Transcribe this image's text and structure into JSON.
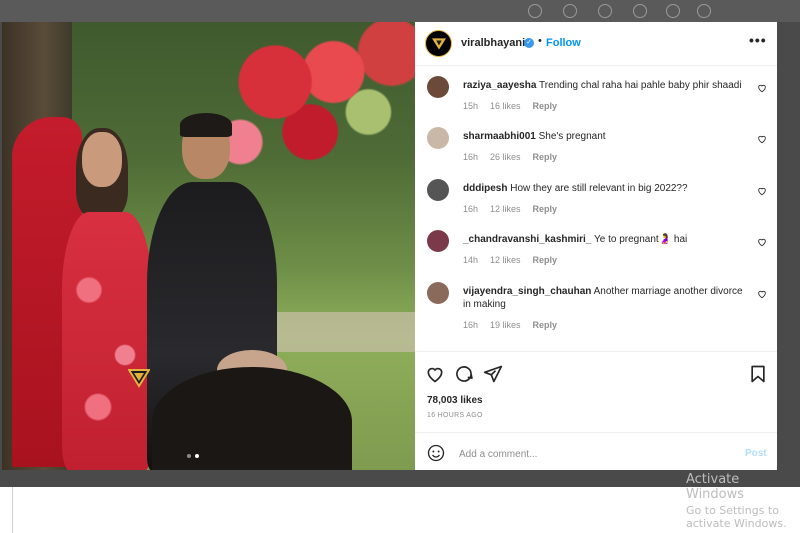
{
  "post": {
    "username": "viralbhayani",
    "follow_label": "Follow",
    "separator": "•",
    "more_label": "•••"
  },
  "comments": [
    {
      "user": "raziya_aayesha",
      "text": "Trending chal raha hai pahle baby phir shaadi",
      "time": "15h",
      "likes": "16 likes",
      "reply": "Reply",
      "avatar_color": "#6b4a3a"
    },
    {
      "user": "sharmaabhi001",
      "text": "She's pregnant",
      "time": "16h",
      "likes": "26 likes",
      "reply": "Reply",
      "avatar_color": "#c9b8a8"
    },
    {
      "user": "dddipesh",
      "text": "How they are still relevant in big 2022??",
      "time": "16h",
      "likes": "12 likes",
      "reply": "Reply",
      "avatar_color": "#555555"
    },
    {
      "user": "_chandravanshi_kashmiri_",
      "text": "Ye to pregnant🤰 hai",
      "time": "14h",
      "likes": "12 likes",
      "reply": "Reply",
      "avatar_color": "#7a3a4a"
    },
    {
      "user": "vijayendra_singh_chauhan",
      "text": "Another marriage another divorce in making",
      "time": "16h",
      "likes": "19 likes",
      "reply": "Reply",
      "avatar_color": "#8a6a5a"
    }
  ],
  "actions": {
    "likes": "78,003 likes",
    "time": "16 HOURS AGO",
    "comment_placeholder": "Add a comment...",
    "post_label": "Post"
  },
  "windows_notice": {
    "line1": "Activate Windows",
    "line2": "Go to Settings to activate Windows."
  },
  "colors": {
    "accent": "#0095f6",
    "verified": "#3897f0",
    "text": "#262626",
    "muted": "#8e8e8e"
  }
}
